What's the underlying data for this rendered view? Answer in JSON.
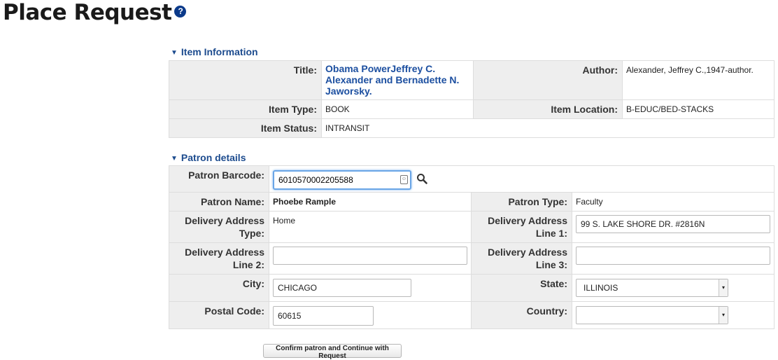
{
  "page": {
    "title": "Place Request",
    "help_icon": "?"
  },
  "item_section": {
    "header": "Item Information",
    "title_label": "Title:",
    "title_value": "Obama PowerJeffrey C. Alexander and Bernadette N. Jaworsky.",
    "author_label": "Author:",
    "author_value": "Alexander, Jeffrey C.,1947-author.",
    "item_type_label": "Item Type:",
    "item_type_value": "BOOK",
    "item_location_label": "Item Location:",
    "item_location_value": "B-EDUC/BED-STACKS",
    "item_status_label": "Item Status:",
    "item_status_value": "INTRANSIT"
  },
  "patron_section": {
    "header": "Patron details",
    "barcode_label": "Patron Barcode:",
    "barcode_value": "6010570002205588",
    "name_label": "Patron Name:",
    "name_value": "Phoebe Rample",
    "type_label": "Patron Type:",
    "type_value": "Faculty",
    "delivery_type_label": "Delivery Address Type:",
    "delivery_type_value": "Home",
    "line1_label": "Delivery Address Line 1:",
    "line1_value": "99 S. LAKE SHORE DR. #2816N",
    "line2_label": "Delivery Address Line 2:",
    "line2_value": "",
    "line3_label": "Delivery Address Line 3:",
    "line3_value": "",
    "city_label": "City:",
    "city_value": "CHICAGO",
    "state_label": "State:",
    "state_value": "ILLINOIS",
    "postal_label": "Postal Code:",
    "postal_value": "60615",
    "country_label": "Country:",
    "country_value": ""
  },
  "actions": {
    "confirm_label": "Confirm patron and Continue with Request"
  },
  "colors": {
    "accent": "#1c4b8e",
    "label_bg": "#eeeeee",
    "focus_border": "#6aa5e6"
  }
}
